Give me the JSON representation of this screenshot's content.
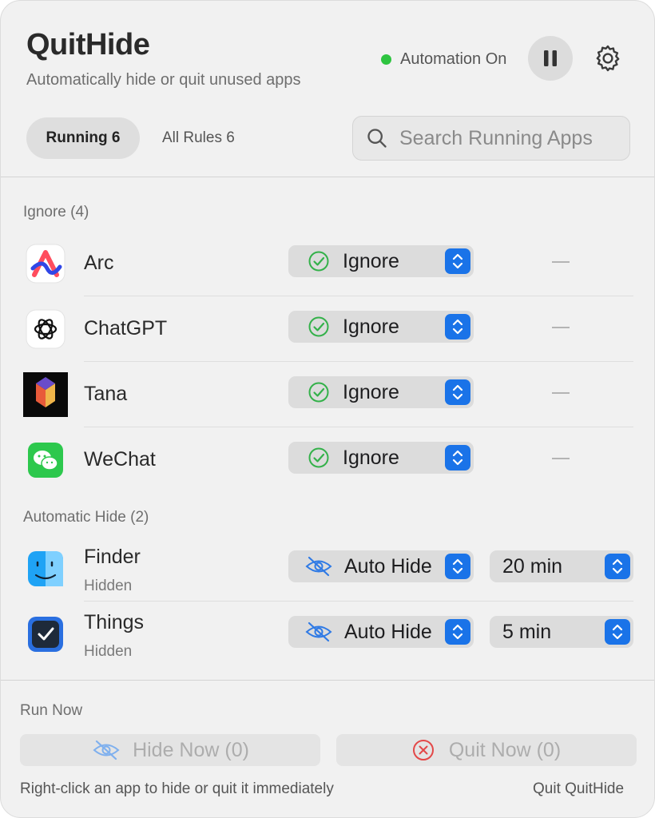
{
  "app": {
    "title": "QuitHide",
    "subtitle": "Automatically hide or quit unused apps"
  },
  "status": {
    "label": "Automation On",
    "color": "#2ec440"
  },
  "header_icons": {
    "pause": "pause-icon",
    "settings": "gear-icon"
  },
  "tabs": [
    {
      "label": "Running 6",
      "active": true
    },
    {
      "label": "All Rules 6",
      "active": false
    }
  ],
  "search": {
    "placeholder": "Search Running Apps",
    "value": ""
  },
  "sections": {
    "ignore": {
      "label": "Ignore (4)",
      "apps": [
        {
          "name": "Arc",
          "action": "Ignore",
          "timeout": "—",
          "icon": "arc-icon"
        },
        {
          "name": "ChatGPT",
          "action": "Ignore",
          "timeout": "—",
          "icon": "chatgpt-icon"
        },
        {
          "name": "Tana",
          "action": "Ignore",
          "timeout": "—",
          "icon": "tana-icon"
        },
        {
          "name": "WeChat",
          "action": "Ignore",
          "timeout": "—",
          "icon": "wechat-icon"
        }
      ]
    },
    "auto_hide": {
      "label": "Automatic Hide (2)",
      "apps": [
        {
          "name": "Finder",
          "status": "Hidden",
          "action": "Auto Hide",
          "delay": "20 min",
          "icon": "finder-icon"
        },
        {
          "name": "Things",
          "status": "Hidden",
          "action": "Auto Hide",
          "delay": "5 min",
          "icon": "things-icon"
        }
      ]
    }
  },
  "run_now": {
    "label": "Run Now",
    "hide_button": "Hide Now (0)",
    "quit_button": "Quit Now (0)"
  },
  "footer": {
    "note": "Right-click an app to hide or quit it immediately",
    "quit_link": "Quit QuitHide"
  },
  "colors": {
    "accent": "#1a73e8",
    "ignore_check": "#34b14a",
    "quit_red": "#e34848",
    "hide_blue": "#2f7ae5"
  }
}
